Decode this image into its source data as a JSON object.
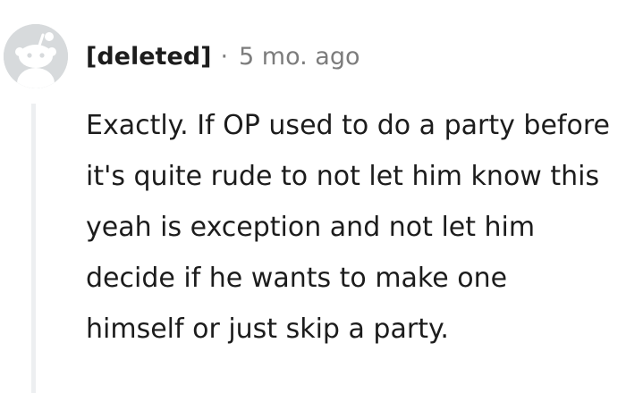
{
  "comment": {
    "author": "[deleted]",
    "separator": "·",
    "age": "5 mo. ago",
    "avatar_icon": "snoo-silhouette-icon",
    "body": "Exactly. If OP used to do a party before it's quite rude to not let him know this yeah is exception and not let him decide if he wants to make one himself or just skip a party."
  },
  "colors": {
    "avatar_background": "#d7dadc",
    "avatar_figure": "#ffffff",
    "text": "#1c1c1c",
    "muted_text": "#7c7c7c",
    "thread_line": "#edeff1"
  }
}
